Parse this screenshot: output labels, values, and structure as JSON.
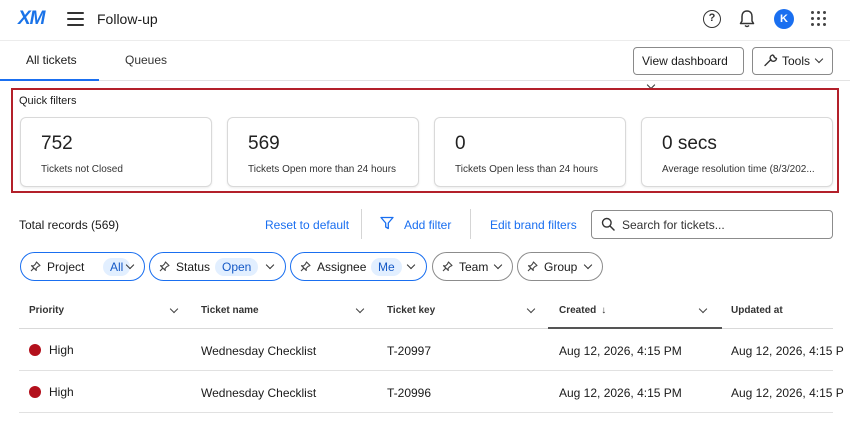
{
  "header": {
    "logo": "XM",
    "title": "Follow-up",
    "help_glyph": "?",
    "avatar_initial": "K"
  },
  "tabs": [
    {
      "label": "All tickets"
    },
    {
      "label": "Queues"
    }
  ],
  "toolbar": {
    "view_dashboard": "View dashboard",
    "tools": "Tools"
  },
  "quick_filters": {
    "label": "Quick filters",
    "cards": [
      {
        "value": "752",
        "desc": "Tickets not Closed"
      },
      {
        "value": "569",
        "desc": "Tickets Open more than 24 hours"
      },
      {
        "value": "0",
        "desc": "Tickets Open less than 24 hours"
      },
      {
        "value": "0 secs",
        "desc": "Average resolution time (8/3/202..."
      }
    ]
  },
  "records": {
    "total": "Total records (569)",
    "reset": "Reset to default",
    "add_filter": "Add filter",
    "edit_brand": "Edit brand filters",
    "search_placeholder": "Search for tickets..."
  },
  "chips": [
    {
      "label": "Project",
      "badge": "All"
    },
    {
      "label": "Status",
      "badge": "Open"
    },
    {
      "label": "Assignee",
      "badge": "Me"
    },
    {
      "label": "Team",
      "badge": ""
    },
    {
      "label": "Group",
      "badge": ""
    }
  ],
  "table": {
    "columns": [
      "Priority",
      "Ticket name",
      "Ticket key",
      "Created",
      "Updated at"
    ],
    "sort_arrow": "↓",
    "rows": [
      {
        "priority": "High",
        "name": "Wednesday Checklist",
        "key": "T-20997",
        "created": "Aug 12, 2026, 4:15 PM",
        "updated": "Aug 12, 2026, 4:15 P"
      },
      {
        "priority": "High",
        "name": "Wednesday Checklist",
        "key": "T-20996",
        "created": "Aug 12, 2026, 4:15 PM",
        "updated": "Aug 12, 2026, 4:15 P"
      }
    ]
  },
  "colors": {
    "accent": "#1a6ff0",
    "highlight_frame": "#b3202a",
    "priority_high": "#b3101c"
  },
  "icons": [
    "menu-icon",
    "help-icon",
    "bell-icon",
    "avatar",
    "apps-grid-icon",
    "wrench-icon",
    "funnel-icon",
    "search-icon",
    "pin-icon",
    "chevron-down-icon",
    "sort-down-icon"
  ]
}
